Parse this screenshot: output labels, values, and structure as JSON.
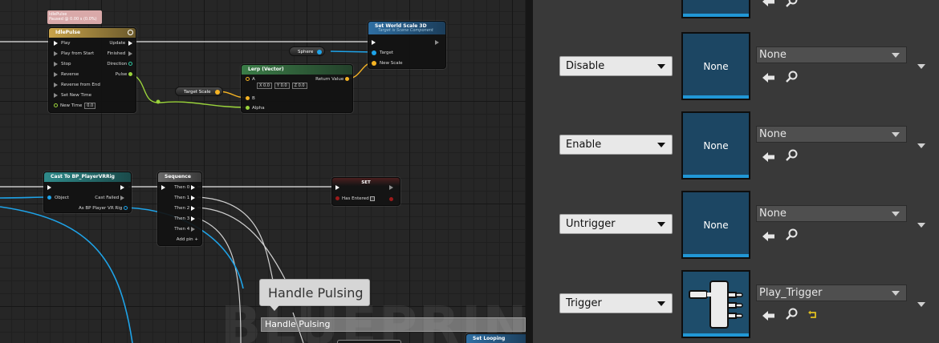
{
  "graph": {
    "watermark": "BLUEPRINT",
    "comment_label": "Handle Pulsing",
    "comment_bar_label": "Handle Pulsing",
    "nodes": {
      "timeline": {
        "bubble_title": "IdlePulse",
        "bubble_sub": "Paused @ 0.00 s (0.0%)",
        "title": "IdlePulse",
        "inputs": [
          "Play",
          "Play from Start",
          "Stop",
          "Reverse",
          "Reverse from End",
          "Set New Time",
          "New Time"
        ],
        "outputs": [
          "Update",
          "Finished",
          "Direction",
          "Pulse"
        ],
        "new_time_value": "0.0"
      },
      "set_world_scale": {
        "title": "Set World Scale 3D",
        "subtitle": "Target is Scene Component",
        "inputs": [
          "Target",
          "New Scale"
        ]
      },
      "sphere_var": "Sphere",
      "target_scale_var": "Target Scale",
      "lerp": {
        "title": "Lerp (Vector)",
        "inputs": [
          "A",
          "B",
          "Alpha"
        ],
        "a_values": [
          "X 0.0",
          "Y 0.0",
          "Z 0.0"
        ],
        "output": "Return Value"
      },
      "cast": {
        "title": "Cast To BP_PlayerVRRig",
        "inputs": [
          "Object"
        ],
        "outputs": [
          "Cast Failed",
          "As BP Player VR Rig"
        ]
      },
      "sequence": {
        "title": "Sequence",
        "outputs": [
          "Then 0",
          "Then 1",
          "Then 2",
          "Then 3",
          "Then 4"
        ],
        "add_pin": "Add pin"
      },
      "set_node": {
        "title": "SET",
        "input": "Has Entered"
      },
      "set_looping": "Set Looping"
    }
  },
  "panel": {
    "rows": [
      {
        "event": "",
        "thumb": "",
        "asset": ""
      },
      {
        "event": "Disable",
        "thumb": "None",
        "asset": "None"
      },
      {
        "event": "Enable",
        "thumb": "None",
        "asset": "None"
      },
      {
        "event": "Untrigger",
        "thumb": "None",
        "asset": "None"
      },
      {
        "event": "Trigger",
        "thumb": "",
        "asset": "Play_Trigger"
      }
    ],
    "icons": [
      "back-arrow-icon",
      "browse-search-icon",
      "reset-arrow-icon"
    ]
  }
}
